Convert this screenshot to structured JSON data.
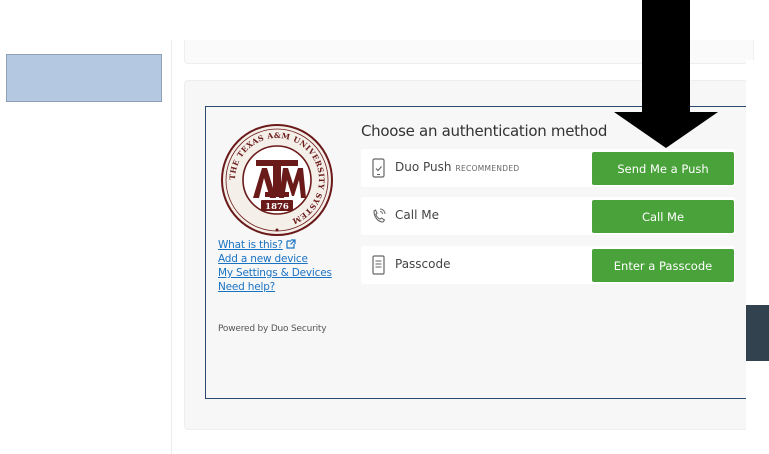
{
  "seal": {
    "ring_text": "THE TEXAS A&M UNIVERSITY SYSTEM",
    "monogram": "ATM",
    "year": "1876"
  },
  "links": {
    "what_is_this": "What is this?",
    "add_device": "Add a new device",
    "settings": "My Settings & Devices",
    "help": "Need help?"
  },
  "powered_by": "Powered by Duo Security",
  "auth": {
    "heading": "Choose an authentication method",
    "methods": [
      {
        "label": "Duo Push",
        "badge": "RECOMMENDED",
        "button": "Send Me a Push",
        "icon": "phone-check-icon"
      },
      {
        "label": "Call Me",
        "badge": "",
        "button": "Call Me",
        "icon": "phone-call-icon"
      },
      {
        "label": "Passcode",
        "badge": "",
        "button": "Enter a Passcode",
        "icon": "passcode-icon"
      }
    ]
  },
  "colors": {
    "button_green": "#4aa23b",
    "frame_border": "#2b4a70",
    "link_blue": "#1a73c2",
    "seal_maroon": "#6b1a1a"
  }
}
